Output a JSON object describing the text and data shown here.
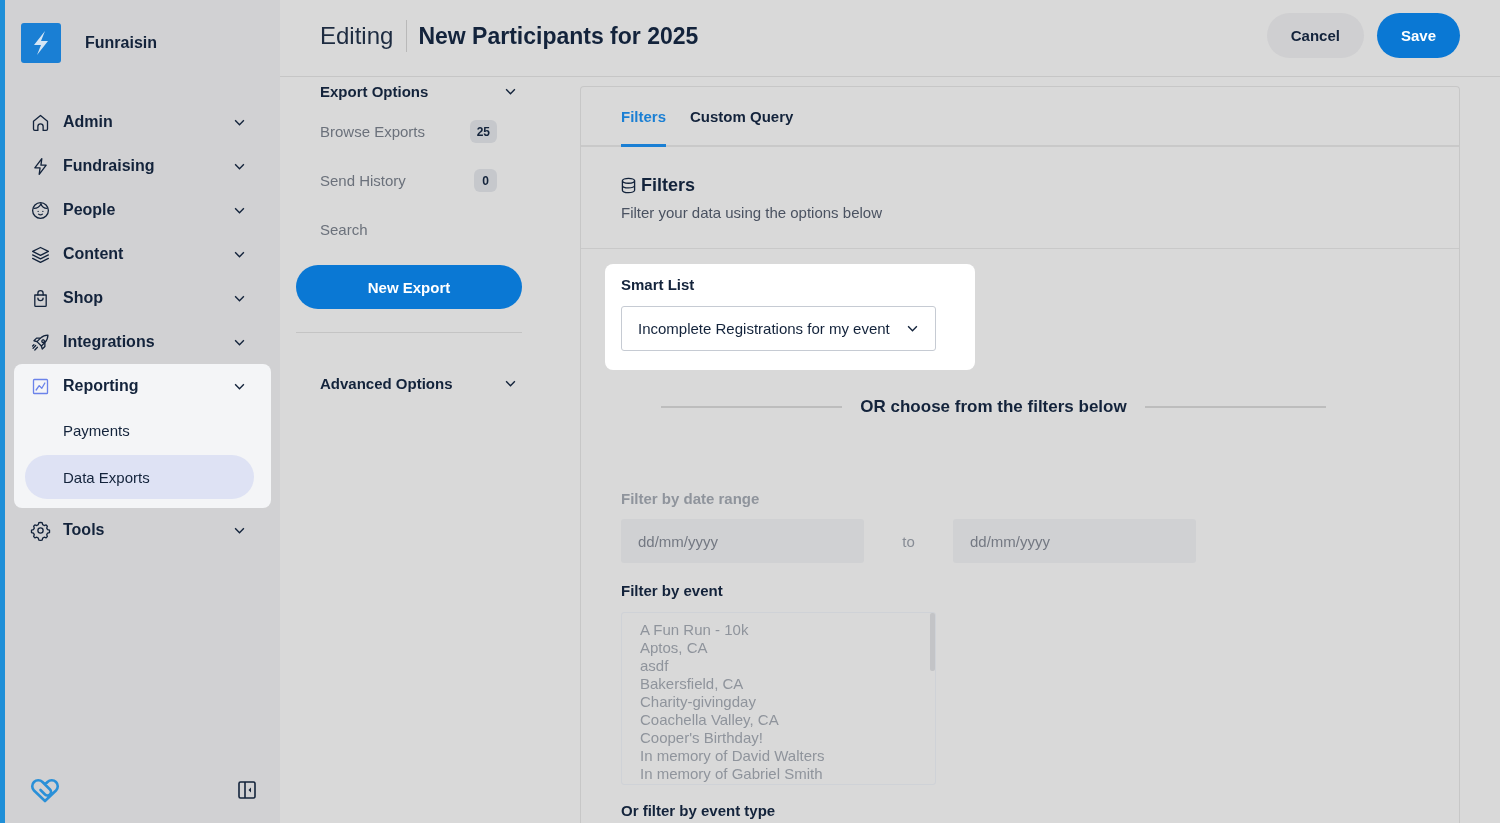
{
  "sidebar": {
    "brand": "Funraisin",
    "items": [
      {
        "label": "Admin",
        "active": false,
        "spotlight": false
      },
      {
        "label": "Fundraising",
        "active": false,
        "spotlight": false
      },
      {
        "label": "People",
        "active": false,
        "spotlight": false
      },
      {
        "label": "Content",
        "active": false,
        "spotlight": false
      },
      {
        "label": "Shop",
        "active": false,
        "spotlight": false
      },
      {
        "label": "Integrations",
        "active": false,
        "spotlight": false
      },
      {
        "label": "Reporting",
        "active": true,
        "spotlight": true,
        "children": [
          {
            "label": "Payments",
            "selected": false
          },
          {
            "label": "Data Exports",
            "selected": true
          }
        ]
      },
      {
        "label": "Tools",
        "active": false,
        "spotlight": false
      }
    ]
  },
  "header": {
    "prefix": "Editing",
    "title": "New Participants for 2025",
    "buttons": [
      {
        "label": "Cancel",
        "kind": "secondary"
      },
      {
        "label": "Save",
        "kind": "primary"
      }
    ]
  },
  "export_panel": {
    "title": "Export Options",
    "links": [
      {
        "label": "Browse Exports",
        "count": "25"
      },
      {
        "label": "Send History",
        "count": "0"
      },
      {
        "label": "Search"
      }
    ],
    "new_button": "New Export",
    "advanced_title": "Advanced Options"
  },
  "filters_panel": {
    "tabs": [
      {
        "label": "Filters",
        "selected": true
      },
      {
        "label": "Custom Query",
        "selected": false
      }
    ],
    "section": {
      "title": "Filters",
      "subtitle": "Filter your data using the options below"
    },
    "smart_list": {
      "label": "Smart List",
      "value": "Incomplete Registrations for my event",
      "spotlight": true
    },
    "divider_text": "OR choose from the filters below",
    "date_range": {
      "label": "Filter by date range",
      "disabled": true,
      "from": {
        "placeholder": "dd/mm/yyyy"
      },
      "separator": "to",
      "to": {
        "placeholder": "dd/mm/yyyy"
      }
    },
    "event_filter": {
      "label": "Filter by event",
      "disabled": true,
      "options": [
        "A Fun Run - 10k",
        "Aptos, CA",
        "asdf",
        "Bakersfield, CA",
        "Charity-givingday",
        "Coachella Valley, CA",
        "Cooper's Birthday!",
        "In memory of David Walters",
        "In memory of Gabriel Smith"
      ]
    },
    "event_type_filter": {
      "label": "Or filter by event type"
    }
  }
}
